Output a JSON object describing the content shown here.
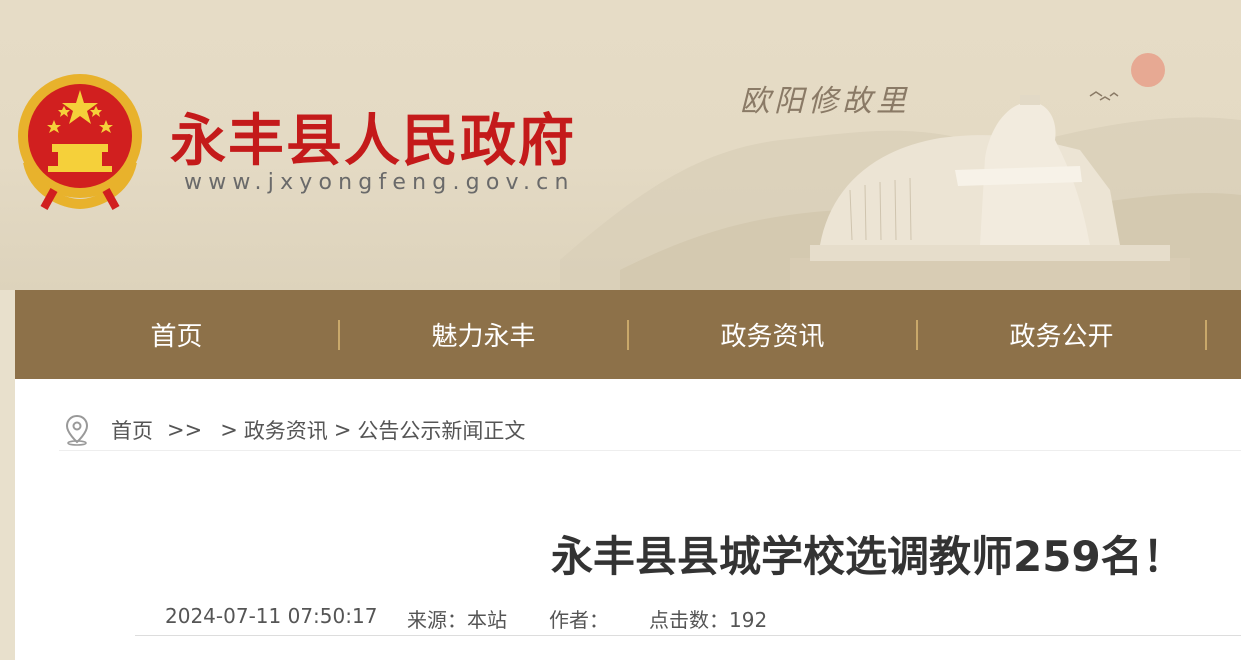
{
  "header": {
    "site_name": "永丰县人民政府",
    "site_url": "www.jxyongfeng.gov.cn",
    "calligraphy": "欧阳修故里",
    "emblem_icon": "national-emblem-icon",
    "accent_color": "#c41a1a"
  },
  "nav": {
    "background": "#8d7149",
    "items": [
      {
        "label": "首页"
      },
      {
        "label": "魅力永丰"
      },
      {
        "label": "政务资讯"
      },
      {
        "label": "政务公开"
      }
    ]
  },
  "breadcrumb": {
    "icon": "location-pin-icon",
    "home": "首页",
    "sep1": ">>",
    "sep2": ">",
    "section": "政务资讯",
    "sep3": ">",
    "page": "公告公示新闻正文"
  },
  "article": {
    "title": "永丰县县城学校选调教师259名！",
    "datetime": "2024-07-11 07:50:17",
    "source_label": "来源：本站",
    "author_label": "作者：",
    "clicks_label": "点击数：192"
  }
}
